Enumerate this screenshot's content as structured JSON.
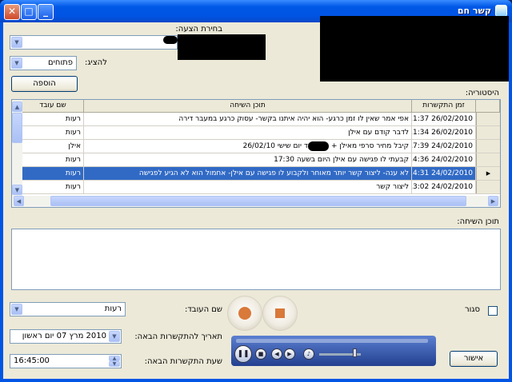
{
  "window": {
    "title": "קשר חם",
    "min": "_",
    "max": "□",
    "close": "✕"
  },
  "form": {
    "offer_label": "בחירת הצעה:",
    "show_label": "להציג:",
    "show_value": "פתוחים",
    "add_button": "הוספה",
    "history_label": "היסטוריה:",
    "content_label": "תוכן השיחה:",
    "worker_label": "שם העובד:",
    "worker_value": "רעות",
    "next_date_label": "תאריך להתקשרות הבאה:",
    "next_date_value": "2010   מרץ    07  יום ראשון",
    "next_time_label": "שעת התקשרות הבאה:",
    "next_time_value": "16:45:00",
    "closed_label": "סגור",
    "ok_button": "אישור"
  },
  "grid": {
    "headers": [
      "זמן התקשרות",
      "תוכן השיחה",
      "שם עובד"
    ],
    "rows": [
      {
        "time": "26/02/2010 11:37",
        "content": "אפי אמר שאין לו זמן כרגע- הוא יהיה איתנו בקשר- עסוק כרגע במעבר דירה",
        "worker": "רעות"
      },
      {
        "time": "26/02/2010 11:34",
        "content": "לדבר קודם עם אילן",
        "worker": "רעות"
      },
      {
        "time": "24/02/2010 17:39",
        "content": "קיבל מחיר סרפי מאילן  + מעמ עד יום שישי 26/02/10",
        "worker": "אילן"
      },
      {
        "time": "24/02/2010 14:36",
        "content": "קבעתי לו פגישה עם אילן היום בשעה 17:30",
        "worker": "רעות"
      },
      {
        "time": "24/02/2010 14:31",
        "content": "לא ענה- ליצור קשר יותר מאוחר ולקבוע לו פגישה עם אילן- אחמול הוא לא הגיע לפגישה",
        "worker": "רעות"
      },
      {
        "time": "24/02/2010 13:02",
        "content": "ליצור קשר",
        "worker": "רעות"
      }
    ]
  },
  "icons": {
    "dropdown": "chevron-down-icon",
    "row_pointer": "triangle-right-icon"
  },
  "colors": {
    "accent": "#0054e3",
    "selection": "#316ac5",
    "record": "#d9793a"
  }
}
